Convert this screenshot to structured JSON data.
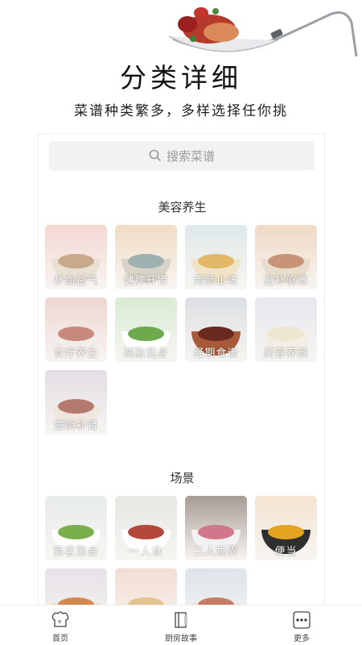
{
  "hero": {
    "title": "分类详细",
    "subtitle": "菜谱种类繁多，多样选择任你挑"
  },
  "search": {
    "placeholder": "搜索菜谱",
    "icon": "search-icon"
  },
  "sections": [
    {
      "title": "美容养生",
      "items": [
        {
          "label": "补血益气",
          "bg": "#f3d7d2",
          "bowl": "#e9e0d4",
          "food": "#c9a98b"
        },
        {
          "label": "健脾开胃",
          "bg": "#f2dcc4",
          "bowl": "#d9d2c8",
          "food": "#9fb0b0"
        },
        {
          "label": "清肺止咳",
          "bg": "#dfe9ea",
          "bowl": "#efe4c8",
          "food": "#e2b866"
        },
        {
          "label": "温补驱寒",
          "bg": "#f0d9c6",
          "bowl": "#e8dccd",
          "food": "#c79478"
        },
        {
          "label": "食疗养生",
          "bg": "#efd6d2",
          "bowl": "#f1ece7",
          "food": "#c78a7c"
        },
        {
          "label": "减脂健身",
          "bg": "#d9ecd4",
          "bowl": "#ffffff",
          "food": "#6eaa4d"
        },
        {
          "label": "经期食谱",
          "bg": "#dcdfe2",
          "bowl": "#a85a3a",
          "food": "#6b2a20"
        },
        {
          "label": "美容养颜",
          "bg": "#e6e8ee",
          "bowl": "#f2eee5",
          "food": "#efe6cf"
        },
        {
          "label": "滋阴补肾",
          "bg": "#e4dde4",
          "bowl": "#f0e6e0",
          "food": "#b57a6f"
        }
      ]
    },
    {
      "title": "场景",
      "items": [
        {
          "label": "宴客聚会",
          "bg": "#e8ecec",
          "bowl": "#ffffff",
          "food": "#7ab04b"
        },
        {
          "label": "一人食",
          "bg": "#e7e7e2",
          "bowl": "#ffffff",
          "food": "#b2493a"
        },
        {
          "label": "二人世界",
          "bg": "#a79b95",
          "bowl": "#f1f1f1",
          "food": "#d1778b"
        },
        {
          "label": "便当",
          "bg": "#f4e3d1",
          "bowl": "#2f2f2f",
          "food": "#e5a41f"
        },
        {
          "label": "",
          "bg": "#e6e2e8",
          "bowl": "#f0e3d6",
          "food": "#d48a4a"
        },
        {
          "label": "",
          "bg": "#f3ddd3",
          "bowl": "#f5ebda",
          "food": "#e4c48e"
        },
        {
          "label": "",
          "bg": "#dde4ea",
          "bowl": "#efe8df",
          "food": "#c87c66"
        }
      ]
    }
  ],
  "bottom_nav": [
    {
      "label": "首页",
      "icon": "home-chef-icon"
    },
    {
      "label": "厨房故事",
      "icon": "book-icon"
    },
    {
      "label": "更多",
      "icon": "more-icon"
    }
  ]
}
